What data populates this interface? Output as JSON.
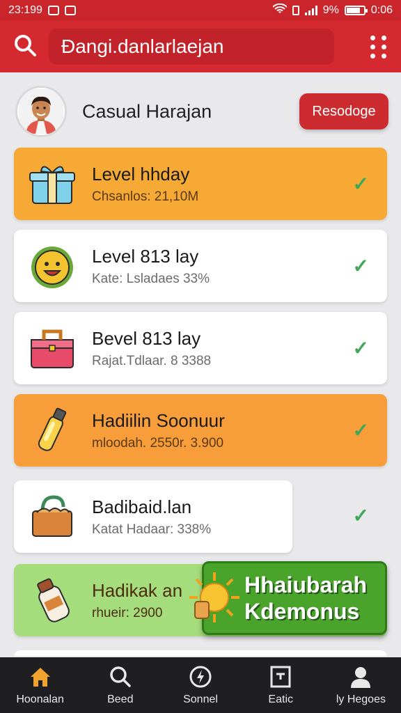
{
  "status": {
    "time_left": "23:199",
    "battery_percent": "9%",
    "time_right": "0:06"
  },
  "header": {
    "search_text": "Đangi.danlarlaejan"
  },
  "profile": {
    "name": "Casual Harajan",
    "action_label": "Resodoge"
  },
  "cards": [
    {
      "title": "Level hhday",
      "subtitle": "Chsanlos: 21,10M",
      "color": "#f7a935",
      "icon": "gift-box-icon",
      "checked": true
    },
    {
      "title": "Level 813 lay",
      "subtitle": "Kate: Lsladaes 33%",
      "color": "#ffffff",
      "icon": "sun-face-icon",
      "checked": true
    },
    {
      "title": "Bevel 813 lay",
      "subtitle": "Rajat.Tdlaar. 8 3388",
      "color": "#ffffff",
      "icon": "toolbox-icon",
      "checked": true
    },
    {
      "title": "Hadiilin Soonuur",
      "subtitle": "mloodah. 2550r. 3.900",
      "color": "#f79d3a",
      "icon": "bottle-icon",
      "checked": true
    },
    {
      "title": "Badibaid.lan",
      "subtitle": "Katat Hadaar: 338%",
      "color": "#ffffff",
      "icon": "basket-icon",
      "checked": true
    },
    {
      "title": "Hadikak an",
      "subtitle": "rhueir: 2900",
      "color": "#a6dd7c",
      "icon": "jar-icon",
      "checked": false
    }
  ],
  "promo": {
    "line1": "Hhaiubarah",
    "line2": "Kdemonus"
  },
  "nav": [
    {
      "label": "Hoonalan",
      "icon": "home-icon",
      "color": "#f2a22f"
    },
    {
      "label": "Beed",
      "icon": "search-icon",
      "color": "#e8e8e8"
    },
    {
      "label": "Sonnel",
      "icon": "compass-icon",
      "color": "#e8e8e8"
    },
    {
      "label": "Eatic",
      "icon": "notes-icon",
      "color": "#e8e8e8"
    },
    {
      "label": "ly Hegoes",
      "icon": "profile-icon",
      "color": "#e8e8e8"
    }
  ]
}
